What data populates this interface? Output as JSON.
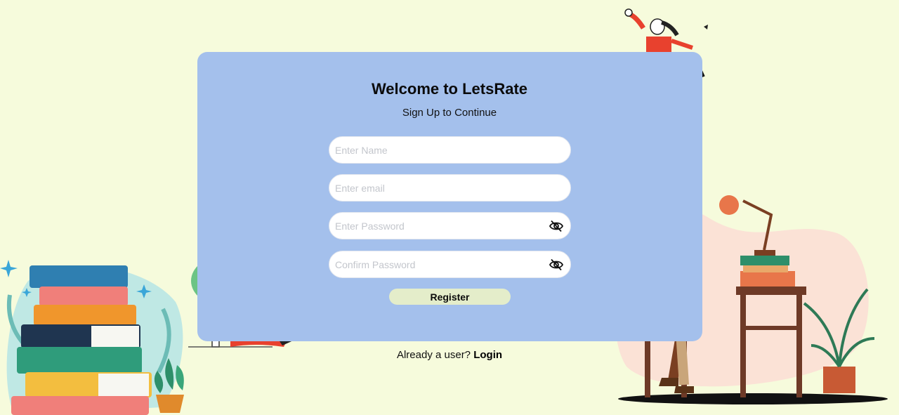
{
  "header": {
    "title": "Welcome to LetsRate",
    "subtitle": "Sign Up to Continue"
  },
  "form": {
    "name_placeholder": "Enter Name",
    "email_placeholder": "Enter email",
    "password_placeholder": "Enter Password",
    "confirm_placeholder": "Confirm Password",
    "register_label": "Register"
  },
  "footer": {
    "prompt": "Already a user?",
    "login_label": "Login"
  },
  "colors": {
    "background": "#f6fbdc",
    "card": "#a4c0ec",
    "register_button": "#e4edca"
  },
  "icons": {
    "password_toggle": "eye-slash-icon"
  }
}
